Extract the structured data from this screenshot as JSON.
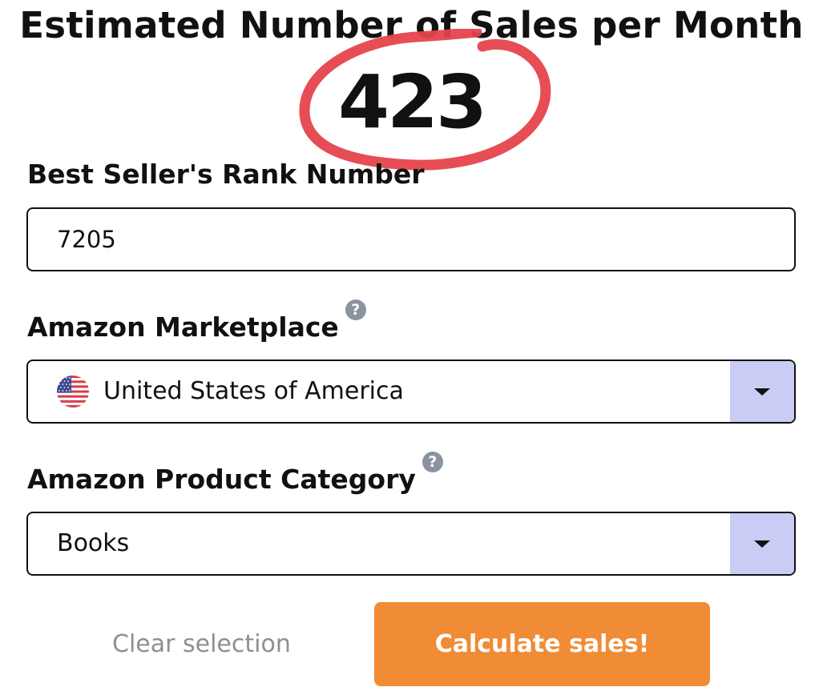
{
  "result": {
    "title": "Estimated Number of Sales per Month",
    "value": "423"
  },
  "rank_field": {
    "label": "Best Seller's Rank Number",
    "value": "7205"
  },
  "marketplace_field": {
    "label": "Amazon Marketplace",
    "help": "?",
    "selected": "United States of America",
    "flag_icon": "us-flag-icon"
  },
  "category_field": {
    "label": "Amazon Product Category",
    "help": "?",
    "selected": "Books"
  },
  "actions": {
    "clear_label": "Clear selection",
    "calculate_label": "Calculate sales!"
  },
  "colors": {
    "button": "#f08c35",
    "select_arrow_bg": "#c9cdf5",
    "help_icon": "#8a939e",
    "annotation_circle": "#e5434b"
  }
}
